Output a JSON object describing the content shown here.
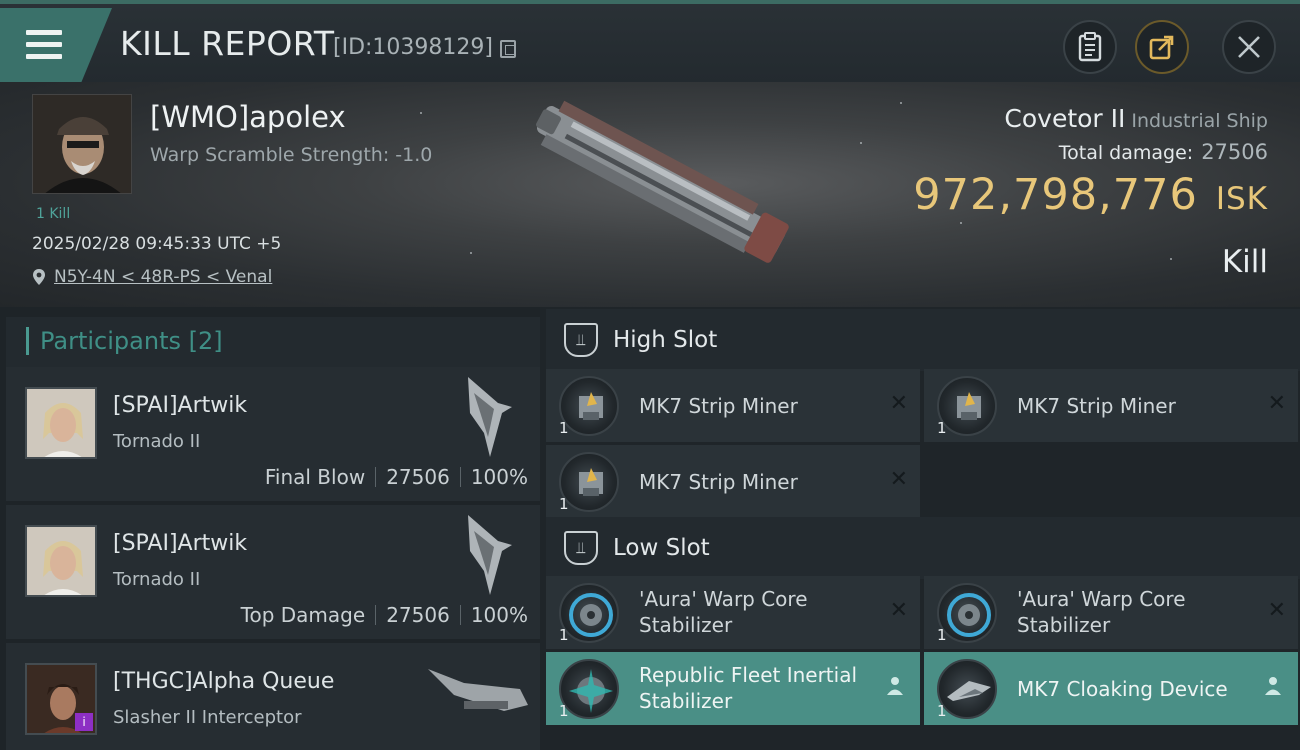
{
  "header": {
    "title": "KILL REPORT",
    "report_id": "[ID:10398129]"
  },
  "victim": {
    "name": "[WMO]apolex",
    "warp_scramble": "Warp Scramble Strength: -1.0",
    "kill_count": "1 Kill",
    "timestamp": "2025/02/28 09:45:33 UTC +5",
    "location": "N5Y-4N < 48R-PS < Venal",
    "ship_name": "Covetor II",
    "ship_class": "Industrial Ship",
    "total_damage_label": "Total damage:",
    "total_damage_value": "27506",
    "isk_value": "972,798,776",
    "isk_unit": "ISK",
    "result": "Kill"
  },
  "participants": {
    "label": "Participants [2]",
    "items": [
      {
        "name": "[SPAI]Artwik",
        "ship": "Tornado II",
        "role": "Final Blow",
        "damage": "27506",
        "percent": "100%"
      },
      {
        "name": "[SPAI]Artwik",
        "ship": "Tornado II",
        "role": "Top Damage",
        "damage": "27506",
        "percent": "100%"
      },
      {
        "name": "[THGC]Alpha Queue",
        "ship": "Slasher II Interceptor",
        "badge": "i"
      }
    ]
  },
  "fittings": {
    "high_slot": {
      "label": "High Slot",
      "modules": [
        {
          "name": "MK7 Strip Miner",
          "qty": "1",
          "state": "destroyed"
        },
        {
          "name": "MK7 Strip Miner",
          "qty": "1",
          "state": "destroyed"
        },
        {
          "name": "MK7 Strip Miner",
          "qty": "1",
          "state": "destroyed"
        }
      ]
    },
    "low_slot": {
      "label": "Low Slot",
      "modules": [
        {
          "name": "'Aura' Warp Core Stabilizer",
          "qty": "1",
          "state": "destroyed"
        },
        {
          "name": "'Aura' Warp Core Stabilizer",
          "qty": "1",
          "state": "destroyed"
        },
        {
          "name": "Republic Fleet Inertial Stabilizer",
          "qty": "1",
          "state": "dropped"
        },
        {
          "name": "MK7 Cloaking Device",
          "qty": "1",
          "state": "dropped"
        }
      ]
    }
  },
  "colors": {
    "accent": "#3a716a",
    "isk_gold": "#e8c77a",
    "dropped_bg": "#4a8f86",
    "participants_label": "#3f8f86"
  },
  "icons": [
    "menu-icon",
    "copy-icon",
    "clipboard-icon",
    "share-icon",
    "close-icon",
    "location-pin-icon",
    "high-slot-icon",
    "low-slot-icon",
    "destroyed-x-icon",
    "person-icon"
  ]
}
